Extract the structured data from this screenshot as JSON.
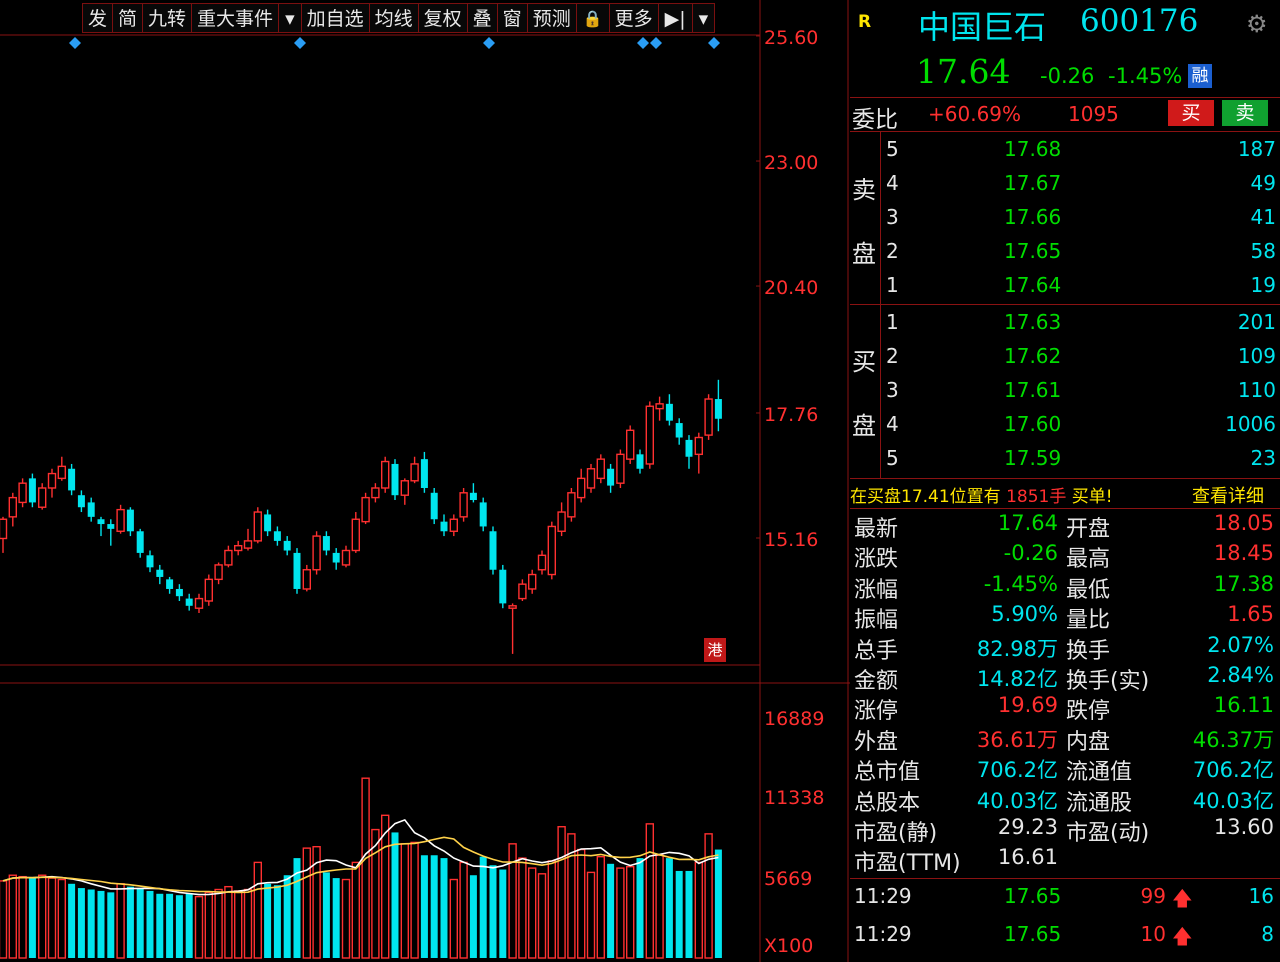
{
  "toolbar": {
    "buttons": [
      "发",
      "简",
      "九转",
      "重大事件",
      "▾",
      "加自选",
      "均线",
      "复权",
      "叠",
      "窗",
      "预测",
      "🔒",
      "更多",
      "▶|",
      "▾"
    ]
  },
  "price_axis": [
    "25.60",
    "23.00",
    "20.40",
    "17.76",
    "15.16"
  ],
  "volume_axis": [
    "16889",
    "11338",
    "5669",
    "X100"
  ],
  "hk_badge": "港",
  "stock": {
    "flag": "R",
    "name": "中国巨石",
    "code": "600176",
    "price": "17.64",
    "change": "-0.26",
    "change_pct": "-1.45%",
    "tag": "融"
  },
  "ratio": {
    "label": "委比",
    "pct": "+60.69%",
    "diff": "1095",
    "buy_label": "买",
    "sell_label": "卖"
  },
  "sell_side": {
    "label_top": "卖",
    "label_bottom": "盘",
    "rows": [
      {
        "lvl": "5",
        "price": "17.68",
        "vol": "187"
      },
      {
        "lvl": "4",
        "price": "17.67",
        "vol": "49"
      },
      {
        "lvl": "3",
        "price": "17.66",
        "vol": "41"
      },
      {
        "lvl": "2",
        "price": "17.65",
        "vol": "58"
      },
      {
        "lvl": "1",
        "price": "17.64",
        "vol": "19"
      }
    ]
  },
  "buy_side": {
    "label_top": "买",
    "label_bottom": "盘",
    "rows": [
      {
        "lvl": "1",
        "price": "17.63",
        "vol": "201"
      },
      {
        "lvl": "2",
        "price": "17.62",
        "vol": "109"
      },
      {
        "lvl": "3",
        "price": "17.61",
        "vol": "110"
      },
      {
        "lvl": "4",
        "price": "17.60",
        "vol": "1006"
      },
      {
        "lvl": "5",
        "price": "17.59",
        "vol": "23"
      }
    ]
  },
  "notice": {
    "text_a": "在买盘",
    "price": "17.41",
    "text_b": "位置有",
    "qty": "1851手",
    "text_c": "买单!",
    "link": "查看详细"
  },
  "stats": [
    {
      "l1": "最新",
      "v1": "17.64",
      "c1": "green",
      "l2": "开盘",
      "v2": "18.05",
      "c2": "red"
    },
    {
      "l1": "涨跌",
      "v1": "-0.26",
      "c1": "green",
      "l2": "最高",
      "v2": "18.45",
      "c2": "red"
    },
    {
      "l1": "涨幅",
      "v1": "-1.45%",
      "c1": "green",
      "l2": "最低",
      "v2": "17.38",
      "c2": "green"
    },
    {
      "l1": "振幅",
      "v1": "5.90%",
      "c1": "cyan",
      "l2": "量比",
      "v2": "1.65",
      "c2": "red"
    },
    {
      "l1": "总手",
      "v1": "82.98万",
      "c1": "cyan",
      "l2": "换手",
      "v2": "2.07%",
      "c2": "cyan"
    },
    {
      "l1": "金额",
      "v1": "14.82亿",
      "c1": "cyan",
      "l2": "换手(实)",
      "v2": "2.84%",
      "c2": "cyan"
    },
    {
      "l1": "涨停",
      "v1": "19.69",
      "c1": "red",
      "l2": "跌停",
      "v2": "16.11",
      "c2": "green"
    },
    {
      "l1": "外盘",
      "v1": "36.61万",
      "c1": "red",
      "l2": "内盘",
      "v2": "46.37万",
      "c2": "green"
    },
    {
      "l1": "总市值",
      "v1": "706.2亿",
      "c1": "cyan",
      "l2": "流通值",
      "v2": "706.2亿",
      "c2": "cyan"
    },
    {
      "l1": "总股本",
      "v1": "40.03亿",
      "c1": "cyan",
      "l2": "流通股",
      "v2": "40.03亿",
      "c2": "cyan"
    },
    {
      "l1": "市盈(静)",
      "v1": "29.23",
      "c1": "white",
      "l2": "市盈(动)",
      "v2": "13.60",
      "c2": "white"
    },
    {
      "l1": "市盈(TTM)",
      "v1": "16.61",
      "c1": "white",
      "l2": "",
      "v2": "",
      "c2": "white"
    }
  ],
  "ticks": [
    {
      "time": "11:29",
      "price": "17.65",
      "vol": "99",
      "arrow": "up",
      "count": "16"
    },
    {
      "time": "11:29",
      "price": "17.65",
      "vol": "10",
      "arrow": "up",
      "count": "8"
    }
  ],
  "colors": {
    "up": "#ff3030",
    "down": "#00e5ee",
    "ma": "#ffd24a",
    "ma2": "#ffffff",
    "border": "#8a1212",
    "panel_text": "#e6e6e6"
  },
  "chart_data": {
    "type": "candlestick",
    "price_ticks": [
      25.6,
      23.0,
      20.4,
      17.76,
      15.16
    ],
    "volume_ticks": [
      16889,
      11338,
      5669
    ],
    "volume_unit": "X100",
    "event_markers": [
      75,
      300,
      489,
      643,
      656,
      714
    ],
    "candles": [
      {
        "o": 15.15,
        "c": 15.55,
        "h": 15.6,
        "l": 14.85,
        "v": 5400
      },
      {
        "o": 15.6,
        "c": 16.0,
        "h": 16.1,
        "l": 15.4,
        "v": 5800
      },
      {
        "o": 15.9,
        "c": 16.3,
        "h": 16.4,
        "l": 15.8,
        "v": 5700
      },
      {
        "o": 16.4,
        "c": 15.9,
        "h": 16.5,
        "l": 15.8,
        "v": 5600
      },
      {
        "o": 15.8,
        "c": 16.2,
        "h": 16.3,
        "l": 15.75,
        "v": 5800
      },
      {
        "o": 16.2,
        "c": 16.5,
        "h": 16.6,
        "l": 16.0,
        "v": 5600
      },
      {
        "o": 16.4,
        "c": 16.65,
        "h": 16.85,
        "l": 16.35,
        "v": 5500
      },
      {
        "o": 16.6,
        "c": 16.15,
        "h": 16.7,
        "l": 16.05,
        "v": 5200
      },
      {
        "o": 16.05,
        "c": 15.8,
        "h": 16.15,
        "l": 15.7,
        "v": 4900
      },
      {
        "o": 15.9,
        "c": 15.6,
        "h": 16.0,
        "l": 15.5,
        "v": 4800
      },
      {
        "o": 15.55,
        "c": 15.45,
        "h": 15.6,
        "l": 15.2,
        "v": 4700
      },
      {
        "o": 15.45,
        "c": 15.35,
        "h": 15.55,
        "l": 15.0,
        "v": 4600
      },
      {
        "o": 15.3,
        "c": 15.75,
        "h": 15.85,
        "l": 15.25,
        "v": 5200
      },
      {
        "o": 15.75,
        "c": 15.3,
        "h": 15.8,
        "l": 15.2,
        "v": 5000
      },
      {
        "o": 15.3,
        "c": 14.85,
        "h": 15.35,
        "l": 14.75,
        "v": 4900
      },
      {
        "o": 14.8,
        "c": 14.55,
        "h": 14.9,
        "l": 14.45,
        "v": 4700
      },
      {
        "o": 14.5,
        "c": 14.35,
        "h": 14.6,
        "l": 14.2,
        "v": 4500
      },
      {
        "o": 14.3,
        "c": 14.1,
        "h": 14.35,
        "l": 14.0,
        "v": 4500
      },
      {
        "o": 14.1,
        "c": 13.95,
        "h": 14.2,
        "l": 13.85,
        "v": 4400
      },
      {
        "o": 13.9,
        "c": 13.75,
        "h": 14.0,
        "l": 13.65,
        "v": 4500
      },
      {
        "o": 13.7,
        "c": 13.9,
        "h": 14.0,
        "l": 13.6,
        "v": 4300
      },
      {
        "o": 13.85,
        "c": 14.3,
        "h": 14.4,
        "l": 13.75,
        "v": 4600
      },
      {
        "o": 14.3,
        "c": 14.6,
        "h": 14.65,
        "l": 14.2,
        "v": 4800
      },
      {
        "o": 14.6,
        "c": 14.9,
        "h": 15.0,
        "l": 14.55,
        "v": 5000
      },
      {
        "o": 14.9,
        "c": 15.0,
        "h": 15.1,
        "l": 14.8,
        "v": 4700
      },
      {
        "o": 14.95,
        "c": 15.1,
        "h": 15.35,
        "l": 14.9,
        "v": 4800
      },
      {
        "o": 15.1,
        "c": 15.7,
        "h": 15.8,
        "l": 15.05,
        "v": 6700
      },
      {
        "o": 15.65,
        "c": 15.3,
        "h": 15.75,
        "l": 15.2,
        "v": 5200
      },
      {
        "o": 15.3,
        "c": 15.1,
        "h": 15.4,
        "l": 15.0,
        "v": 5100
      },
      {
        "o": 15.1,
        "c": 14.9,
        "h": 15.2,
        "l": 14.8,
        "v": 5800
      },
      {
        "o": 14.85,
        "c": 14.1,
        "h": 14.95,
        "l": 14.0,
        "v": 7000
      },
      {
        "o": 14.1,
        "c": 14.5,
        "h": 14.6,
        "l": 14.05,
        "v": 7700
      },
      {
        "o": 14.5,
        "c": 15.2,
        "h": 15.3,
        "l": 14.4,
        "v": 7800
      },
      {
        "o": 15.2,
        "c": 14.9,
        "h": 15.3,
        "l": 14.8,
        "v": 6000
      },
      {
        "o": 14.85,
        "c": 14.65,
        "h": 14.95,
        "l": 14.5,
        "v": 5600
      },
      {
        "o": 14.6,
        "c": 14.9,
        "h": 15.0,
        "l": 14.55,
        "v": 5500
      },
      {
        "o": 14.9,
        "c": 15.55,
        "h": 15.7,
        "l": 14.85,
        "v": 6700
      },
      {
        "o": 15.5,
        "c": 16.0,
        "h": 16.1,
        "l": 15.45,
        "v": 12600
      },
      {
        "o": 16.0,
        "c": 16.2,
        "h": 16.3,
        "l": 15.9,
        "v": 9000
      },
      {
        "o": 16.2,
        "c": 16.75,
        "h": 16.85,
        "l": 16.1,
        "v": 10000
      },
      {
        "o": 16.7,
        "c": 16.05,
        "h": 16.8,
        "l": 15.95,
        "v": 8800
      },
      {
        "o": 16.05,
        "c": 16.35,
        "h": 16.4,
        "l": 15.85,
        "v": 8000
      },
      {
        "o": 16.35,
        "c": 16.7,
        "h": 16.85,
        "l": 16.3,
        "v": 8100
      },
      {
        "o": 16.8,
        "c": 16.2,
        "h": 16.95,
        "l": 16.1,
        "v": 7200
      },
      {
        "o": 16.1,
        "c": 15.55,
        "h": 16.2,
        "l": 15.45,
        "v": 7200
      },
      {
        "o": 15.5,
        "c": 15.3,
        "h": 15.65,
        "l": 15.2,
        "v": 7000
      },
      {
        "o": 15.3,
        "c": 15.55,
        "h": 15.65,
        "l": 15.2,
        "v": 5500
      },
      {
        "o": 15.6,
        "c": 16.1,
        "h": 16.2,
        "l": 15.5,
        "v": 6700
      },
      {
        "o": 16.1,
        "c": 15.95,
        "h": 16.3,
        "l": 15.9,
        "v": 5800
      },
      {
        "o": 15.9,
        "c": 15.4,
        "h": 16.0,
        "l": 15.3,
        "v": 7100
      },
      {
        "o": 15.3,
        "c": 14.5,
        "h": 15.4,
        "l": 14.4,
        "v": 6500
      },
      {
        "o": 14.5,
        "c": 13.8,
        "h": 14.6,
        "l": 13.7,
        "v": 6200
      },
      {
        "o": 13.7,
        "c": 13.75,
        "h": 13.8,
        "l": 12.75,
        "v": 8000
      },
      {
        "o": 13.9,
        "c": 14.2,
        "h": 14.3,
        "l": 13.85,
        "v": 7000
      },
      {
        "o": 14.1,
        "c": 14.4,
        "h": 14.5,
        "l": 14.0,
        "v": 6300
      },
      {
        "o": 14.5,
        "c": 14.8,
        "h": 14.9,
        "l": 14.4,
        "v": 5900
      },
      {
        "o": 14.4,
        "c": 15.4,
        "h": 15.5,
        "l": 14.3,
        "v": 6800
      },
      {
        "o": 15.3,
        "c": 15.7,
        "h": 15.9,
        "l": 15.2,
        "v": 9200
      },
      {
        "o": 15.6,
        "c": 16.1,
        "h": 16.2,
        "l": 15.5,
        "v": 8700
      },
      {
        "o": 16.0,
        "c": 16.4,
        "h": 16.6,
        "l": 15.9,
        "v": 7600
      },
      {
        "o": 16.2,
        "c": 16.6,
        "h": 16.7,
        "l": 16.1,
        "v": 6000
      },
      {
        "o": 16.4,
        "c": 16.8,
        "h": 16.9,
        "l": 16.3,
        "v": 7100
      },
      {
        "o": 16.6,
        "c": 16.25,
        "h": 16.7,
        "l": 16.1,
        "v": 6600
      },
      {
        "o": 16.3,
        "c": 16.9,
        "h": 17.0,
        "l": 16.2,
        "v": 6300
      },
      {
        "o": 16.8,
        "c": 17.4,
        "h": 17.5,
        "l": 16.7,
        "v": 6400
      },
      {
        "o": 16.9,
        "c": 16.6,
        "h": 17.0,
        "l": 16.5,
        "v": 7000
      },
      {
        "o": 16.7,
        "c": 17.9,
        "h": 18.0,
        "l": 16.6,
        "v": 9400
      },
      {
        "o": 17.85,
        "c": 17.95,
        "h": 18.1,
        "l": 17.6,
        "v": 7200
      },
      {
        "o": 17.95,
        "c": 17.6,
        "h": 18.15,
        "l": 17.5,
        "v": 7000
      },
      {
        "o": 17.55,
        "c": 17.25,
        "h": 17.65,
        "l": 17.1,
        "v": 6100
      },
      {
        "o": 17.2,
        "c": 16.85,
        "h": 17.3,
        "l": 16.6,
        "v": 6100
      },
      {
        "o": 16.9,
        "c": 17.25,
        "h": 17.35,
        "l": 16.5,
        "v": 6700
      },
      {
        "o": 17.3,
        "c": 18.05,
        "h": 18.15,
        "l": 17.2,
        "v": 8700
      },
      {
        "o": 18.05,
        "c": 17.64,
        "h": 18.45,
        "l": 17.38,
        "v": 7600
      }
    ]
  }
}
